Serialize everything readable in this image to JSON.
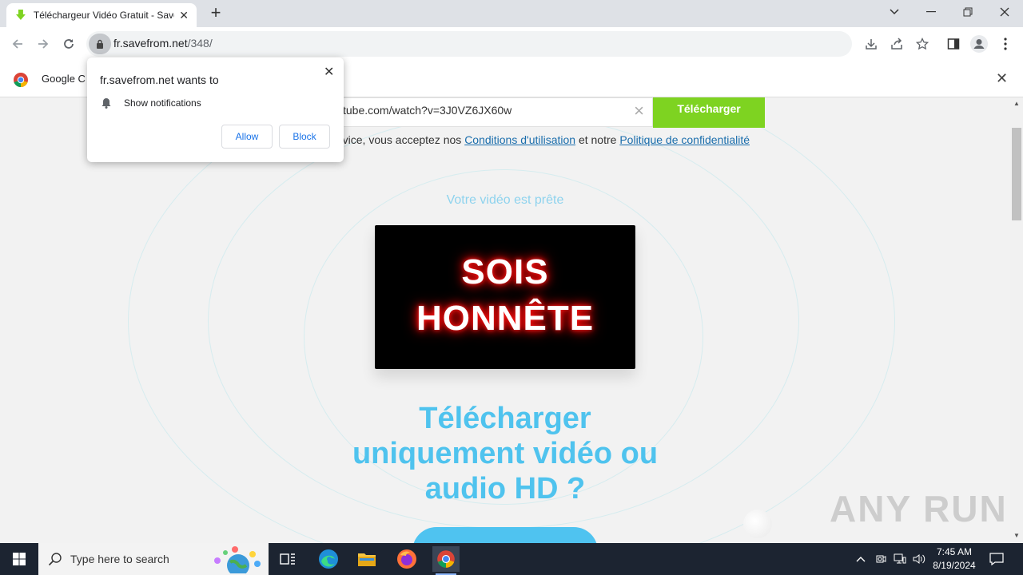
{
  "browser": {
    "tab_title": "Téléchargeur Vidéo Gratuit - Save",
    "new_tab_symbol": "+",
    "url_domain": "fr.savefrom.net",
    "url_path": "/348/"
  },
  "google_bar": {
    "text": "Google C"
  },
  "permission_popup": {
    "title": "fr.savefrom.net wants to",
    "permission": "Show notifications",
    "allow_label": "Allow",
    "block_label": "Block"
  },
  "page": {
    "url_input_value": "tube.com/watch?v=3J0VZ6JX60w",
    "download_button": "Télécharger",
    "terms_prefix": "rvice, vous acceptez nos ",
    "terms_link": "Conditions d'utilisation",
    "terms_middle": " et notre ",
    "privacy_link": "Politique de confidentialité",
    "ready_text": "Votre vidéo est prête",
    "video_line1": "SOIS",
    "video_line2": "HONNÊTE",
    "headline_line1": "Télécharger",
    "headline_line2": "uniquement vidéo ou",
    "headline_line3": "audio HD ?"
  },
  "watermark": "ANY RUN",
  "taskbar": {
    "search_placeholder": "Type here to search",
    "time": "7:45 AM",
    "date": "8/19/2024"
  },
  "colors": {
    "download_green": "#7ed321",
    "headline_blue": "#4fc3ee",
    "link_blue": "#1a6dac"
  }
}
